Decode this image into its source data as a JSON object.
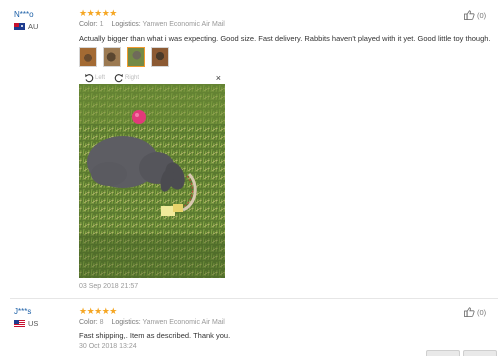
{
  "reviews": [
    {
      "user": "N***o",
      "country": "AU",
      "stars": "★★★★★",
      "color_label": "Color:",
      "color_value": "1",
      "logistics_label": "Logistics:",
      "logistics_value": "Yanwen Economic Air Mail",
      "text": "Actually bigger than what i was expecting. Good size. Fast delivery. Rabbits haven't played with it yet. Good little toy though.",
      "date": "03 Sep 2018 21:57",
      "helpful_count": "(0)",
      "image_count": 4,
      "viewer": {
        "left_label": "Left",
        "right_label": "Right",
        "close_label": "×"
      }
    },
    {
      "user": "J***s",
      "country": "US",
      "stars": "★★★★★",
      "color_label": "Color:",
      "color_value": "8",
      "logistics_label": "Logistics:",
      "logistics_value": "Yanwen Economic Air Mail",
      "text": "Fast shipping,. Item as described. Thank you.",
      "date": "30 Oct 2018 13:24",
      "helpful_count": "(0)"
    }
  ],
  "colors": {
    "link": "#1a5ea6",
    "star": "#f5a623",
    "muted": "#999999"
  },
  "icons": [
    "thumbs-up-icon",
    "rotate-left-icon",
    "rotate-right-icon",
    "close-icon",
    "flag-au-icon",
    "flag-us-icon"
  ]
}
